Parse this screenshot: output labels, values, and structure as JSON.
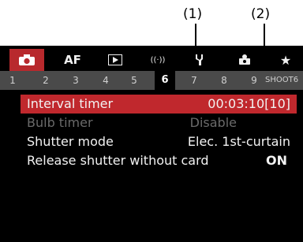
{
  "callouts": [
    "(1)",
    "(2)"
  ],
  "tabs": [
    {
      "name": "camera-icon",
      "label": ""
    },
    {
      "name": "af-tab",
      "label": "AF"
    },
    {
      "name": "playback-icon",
      "label": "▶"
    },
    {
      "name": "wireless-icon",
      "label": "((·))"
    },
    {
      "name": "wrench-icon",
      "label": ""
    },
    {
      "name": "custom-icon",
      "label": ""
    },
    {
      "name": "star-icon",
      "label": "★"
    }
  ],
  "pages": [
    "1",
    "2",
    "3",
    "4",
    "5",
    "6",
    "7",
    "8",
    "9",
    "SHOOT6"
  ],
  "active_page": "6",
  "menu": [
    {
      "label": "Interval timer",
      "value": "00:03:10[10]",
      "state": "selected"
    },
    {
      "label": "Bulb timer",
      "value": "Disable",
      "state": "disabled"
    },
    {
      "label": "Shutter mode",
      "value": "Elec. 1st-curtain",
      "state": "normal"
    },
    {
      "label": "Release shutter without card",
      "value": "ON",
      "state": "normal"
    }
  ],
  "colors": {
    "accent": "#c0282d",
    "background": "#000000",
    "page_bar": "#4a4a4a"
  }
}
